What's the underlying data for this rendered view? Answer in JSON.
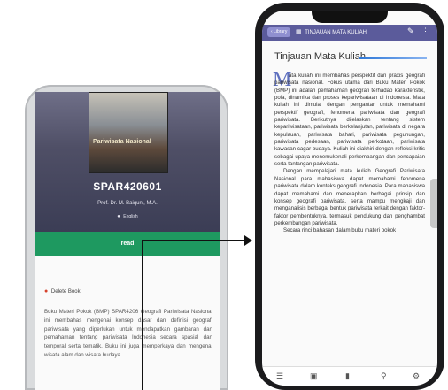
{
  "left_screen": {
    "cover_title": "Pariwisata Nasional",
    "book_code": "SPAR420601",
    "author": "Prof. Dr. M. Baiquni, M.A.",
    "language": "English",
    "read_button": "read",
    "delete_label": "Delete Book",
    "description": "Buku Materi Pokok (BMP) SPAR4206 Geografi Pariwisata Nasional ini membahas mengenai konsep dasar dan definisi geografi pariwisata yang diperlukan untuk mendapatkan gambaran dan pemahaman tentang pariwisata Indonesia secara spasial dan temporal serta tematik. Buku ini juga memperkaya dan mengenai wisata alam dan wisata budaya..."
  },
  "right_screen": {
    "back_label": "Library",
    "header_title": "TINJAUAN MATA KULIAH",
    "section_title": "Tinjauan Mata Kuliah",
    "dropcap": "M",
    "paragraph1": "ata kuliah ini membahas perspektif dan praxis geografi pariwisata nasional. Fokus utama dari Buku Materi Pokok (BMP) ini adalah pemahaman geografi terhadap karakteristik, pola, dinamika dan proses kepariwisataan di Indonesia. Mata kuliah ini dimulai dengan pengantar untuk memahami perspektif geografi, fenomena pariwisata dan geografi pariwisata. Berikutnya dijelaskan tentang sistem kepariwisataan, pariwisata berkelanjutan, pariwisata di negara kepulauan, pariwisata bahari, pariwisata pegunungan, pariwisata pedesaan, pariwisata perkotaan, pariwisata kawasan cagar budaya. Kuliah ini diakhiri dengan refleksi kritis sebagai upaya menemukenali perkembangan dan pencapaian serta tantangan pariwisata.",
    "paragraph2": "Dengan mempelajari mata kuliah Geografi Pariwisata Nasional para mahasiswa dapat memahami fenomena pariwisata dalam konteks geografi Indonesia. Para mahasiswa dapat memahami dan menerapkan berbagai prinsip dan konsep geografi pariwisata, serta mampu mengkaji dan menganalisis berbagai bentuk pariwisata terkait dengan faktor-faktor pembentuknya, termasuk pendukung dan penghambat perkembangan pariwisata.",
    "paragraph3": "Secara rinci bahasan dalam buku materi pokok"
  },
  "icons": {
    "back": "chevron-left-icon",
    "doc": "document-icon",
    "edit": "edit-icon",
    "menu": "menu-icon",
    "toolbar": [
      "list-icon",
      "image-icon",
      "bookmark-icon",
      "search-icon",
      "settings-icon"
    ]
  },
  "colors": {
    "read_button": "#1e9960",
    "topbar": "#5b5b9b",
    "dropcap": "#5d6fbf",
    "delete_icon": "#d6422c"
  }
}
